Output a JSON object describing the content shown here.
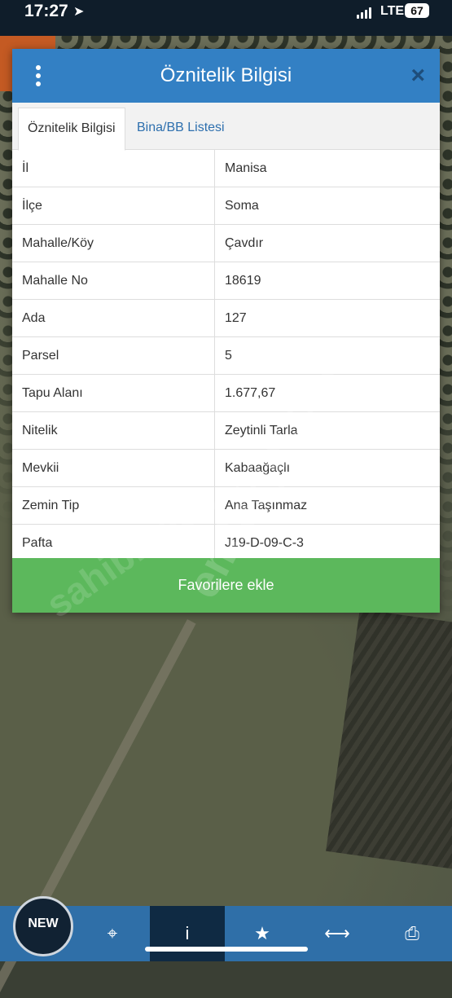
{
  "status_bar": {
    "time": "17:27",
    "network": "LTE",
    "battery": "67"
  },
  "dialog": {
    "title": "Öznitelik Bilgisi",
    "tabs": [
      {
        "label": "Öznitelik Bilgisi",
        "active": true
      },
      {
        "label": "Bina/BB Listesi",
        "active": false
      }
    ],
    "rows": [
      {
        "key": "İl",
        "value": "Manisa"
      },
      {
        "key": "İlçe",
        "value": "Soma"
      },
      {
        "key": "Mahalle/Köy",
        "value": "Çavdır"
      },
      {
        "key": "Mahalle No",
        "value": "18619"
      },
      {
        "key": "Ada",
        "value": "127"
      },
      {
        "key": "Parsel",
        "value": "5"
      },
      {
        "key": "Tapu Alanı",
        "value": "1.677,67"
      },
      {
        "key": "Nitelik",
        "value": "Zeytinli Tarla"
      },
      {
        "key": "Mevkii",
        "value": "Kabaağaçlı"
      },
      {
        "key": "Zemin Tip",
        "value": "Ana Taşınmaz"
      },
      {
        "key": "Pafta",
        "value": "J19-D-09-C-3"
      }
    ],
    "favorite_button": "Favorilere ekle"
  },
  "watermark": {
    "text1": "emlakjet.com",
    "text2": "sahibinden"
  },
  "logo": {
    "text": "NEW"
  },
  "bottom_bar": {
    "items": [
      {
        "icon": "locate-icon",
        "glyph": "⌖"
      },
      {
        "icon": "info-icon",
        "glyph": "i"
      },
      {
        "icon": "star-icon",
        "glyph": "★"
      },
      {
        "icon": "measure-icon",
        "glyph": "⟷"
      },
      {
        "icon": "print-icon",
        "glyph": "⎙"
      }
    ]
  },
  "colors": {
    "header": "#3380c4",
    "button": "#5cb85c",
    "bottom_bar": "#2f6fa8"
  }
}
